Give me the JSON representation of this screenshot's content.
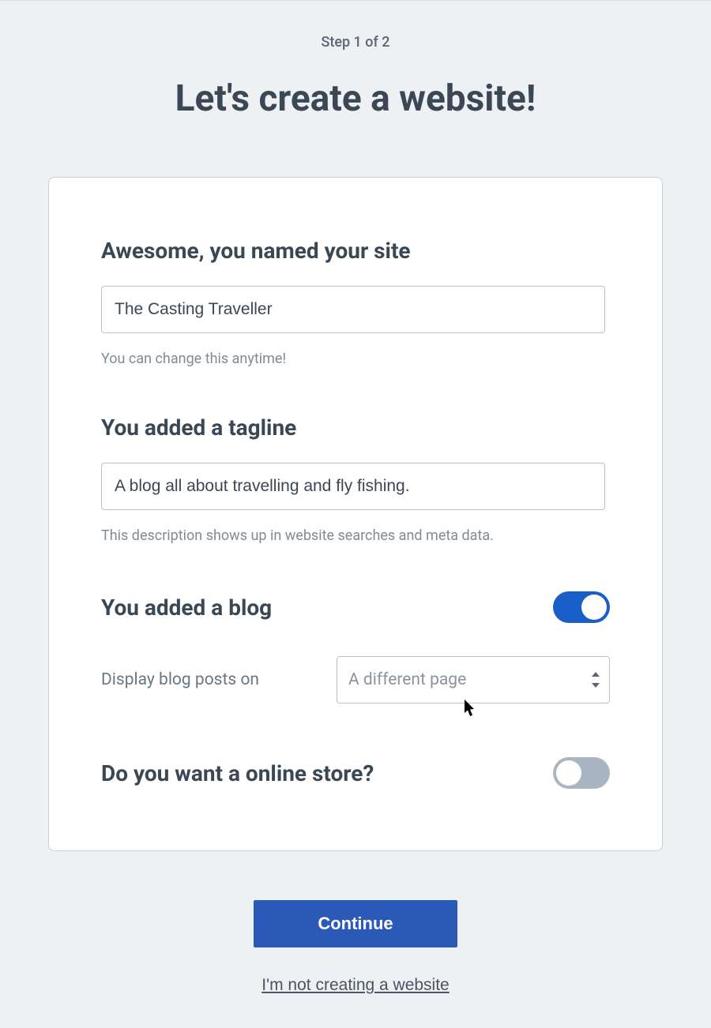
{
  "header": {
    "step": "Step 1 of 2",
    "title": "Let's create a website!"
  },
  "site_name": {
    "heading": "Awesome, you named your site",
    "value": "The Casting Traveller",
    "helper": "You can change this anytime!"
  },
  "tagline": {
    "heading": "You added a tagline",
    "value": "A blog all about travelling and fly fishing.",
    "helper": "This description shows up in website searches and meta data."
  },
  "blog": {
    "heading": "You added a blog",
    "toggle_on": true,
    "display_label": "Display blog posts on",
    "display_value": "A different page"
  },
  "store": {
    "heading": "Do you want a online store?",
    "toggle_on": false
  },
  "footer": {
    "continue": "Continue",
    "skip": "I'm not creating a website"
  },
  "colors": {
    "accent": "#2a59b8",
    "toggle_on": "#1a5fc9",
    "toggle_off": "#a9b5c0",
    "page_bg": "#edf1f4"
  }
}
